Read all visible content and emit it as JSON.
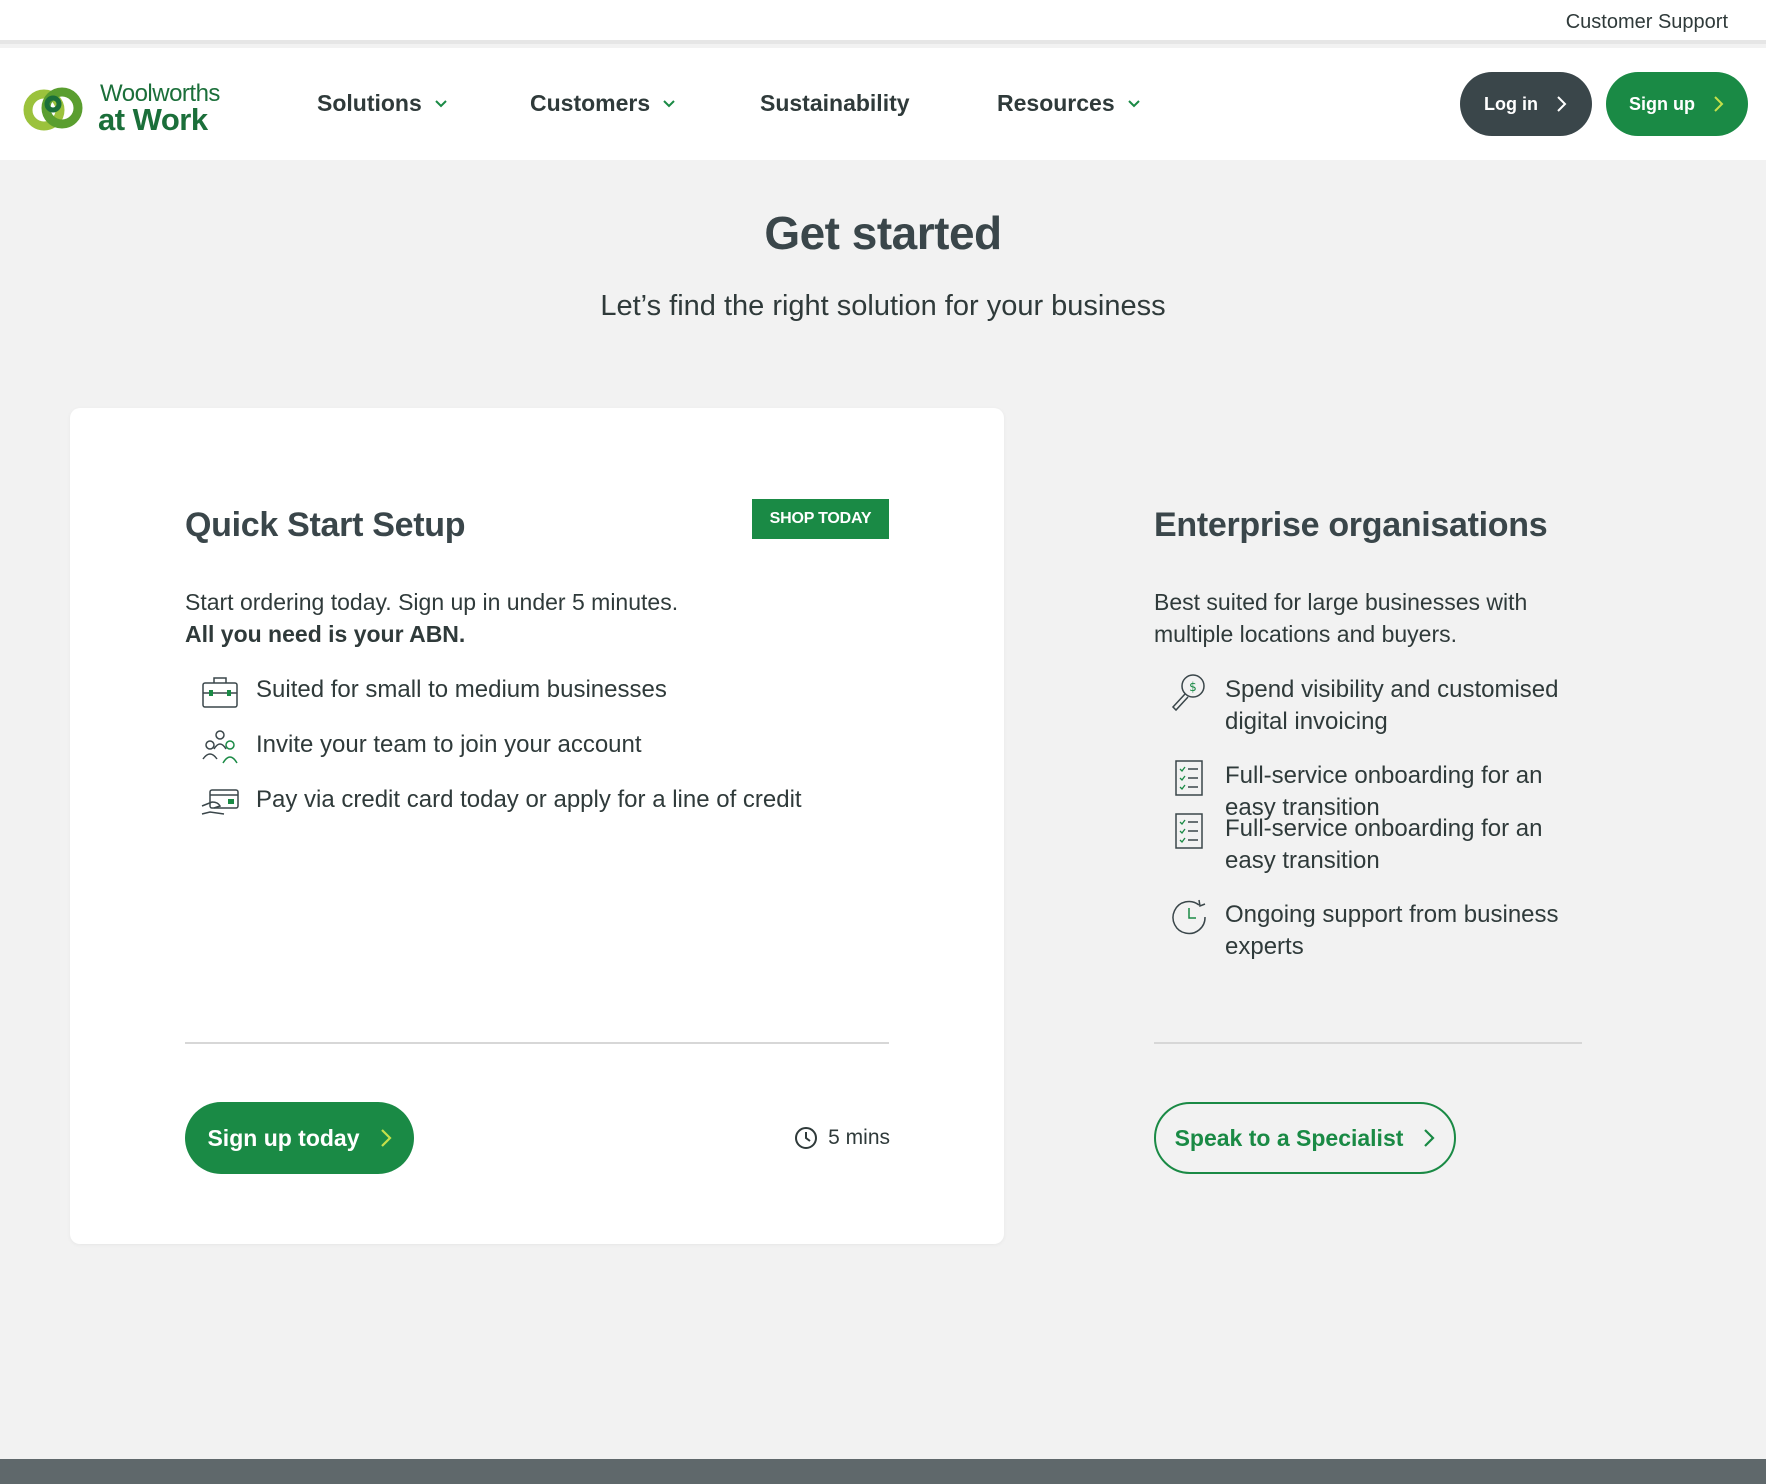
{
  "utility": {
    "customer_support": "Customer Support"
  },
  "brand": {
    "line1": "Woolworths",
    "line2": "at Work",
    "color": "#1b6f3a"
  },
  "nav": {
    "items": [
      {
        "label": "Solutions",
        "has_dropdown": true
      },
      {
        "label": "Customers",
        "has_dropdown": true
      },
      {
        "label": "Sustainability",
        "has_dropdown": false
      },
      {
        "label": "Resources",
        "has_dropdown": true
      }
    ],
    "login_label": "Log in",
    "signup_label": "Sign up"
  },
  "hero": {
    "title": "Get started",
    "subtitle": "Let’s find the right solution for your business"
  },
  "quick_start": {
    "title": "Quick Start Setup",
    "badge": "SHOP TODAY",
    "desc_line1": "Start ordering today. Sign up in under 5 minutes.",
    "desc_line2": "All you need is your ABN.",
    "features": [
      {
        "icon": "briefcase-icon",
        "text": "Suited for small to medium businesses"
      },
      {
        "icon": "team-icon",
        "text": "Invite your team to join your account"
      },
      {
        "icon": "credit-card-icon",
        "text": "Pay via credit card today or apply for a line of credit"
      }
    ],
    "cta_label": "Sign up today",
    "time_label": "5 mins"
  },
  "enterprise": {
    "title": "Enterprise organisations",
    "desc": "Best suited for large businesses with multiple locations and buyers.",
    "features": [
      {
        "icon": "dollar-search-icon",
        "text": "Spend visibility and customised digital invoicing"
      },
      {
        "icon": "checklist-icon",
        "text": "Full-service onboarding for an easy transition"
      },
      {
        "icon": "checklist-icon",
        "text": "Full-service onboarding for an easy transition"
      },
      {
        "icon": "clock-support-icon",
        "text": "Ongoing support from business experts"
      }
    ],
    "cta_label": "Speak to a Specialist"
  },
  "colors": {
    "primary_green": "#1a8a45",
    "dark_slate": "#3a464a",
    "background": "#f2f2f2",
    "footer": "#5f686b"
  }
}
